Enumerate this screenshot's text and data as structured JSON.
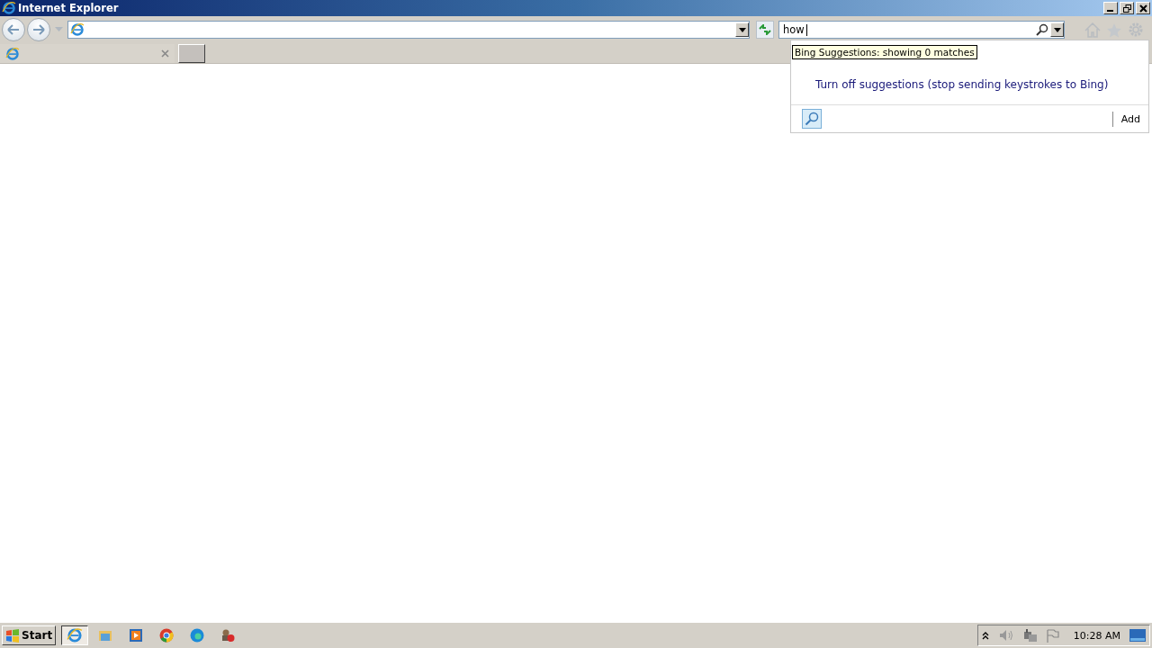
{
  "window": {
    "title": "Internet Explorer"
  },
  "search_box": {
    "value": "how"
  },
  "tabs": [
    {
      "selected": true
    }
  ],
  "suggestions": {
    "tooltip": "Bing Suggestions: showing 0 matches",
    "turn_off_link": "Turn off suggestions (stop sending keystrokes to Bing)",
    "add_button": "Add"
  },
  "taskbar": {
    "start": "Start",
    "apps": [
      {
        "kind": "ie",
        "selected": true
      },
      {
        "kind": "folder",
        "selected": false
      },
      {
        "kind": "media",
        "selected": false
      },
      {
        "kind": "chrome",
        "selected": false
      },
      {
        "kind": "edge",
        "selected": false
      },
      {
        "kind": "tool",
        "selected": false
      }
    ],
    "clock": "10:28 AM"
  }
}
